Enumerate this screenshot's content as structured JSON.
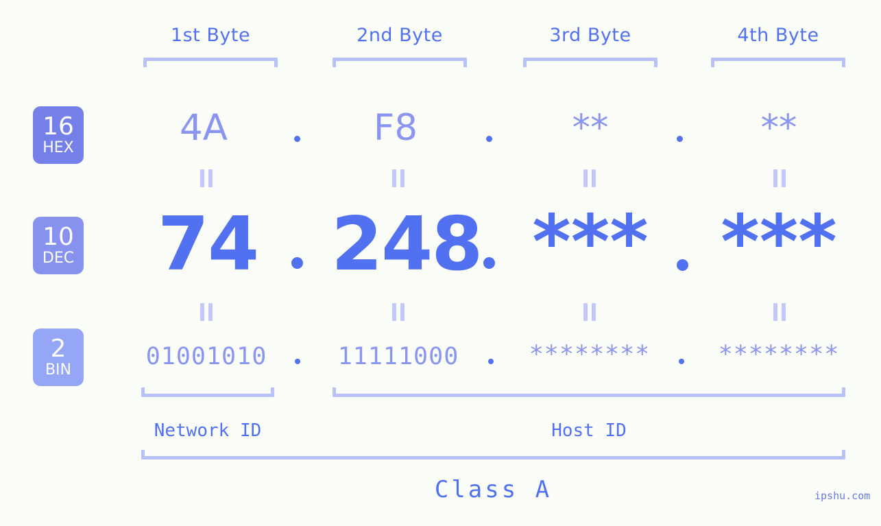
{
  "meta": {
    "background_color": "#fbfdf9",
    "accent_color": "#5271f0",
    "muted_accent_color": "#8a95ef",
    "bracket_color": "#b9c2f8",
    "watermark": "ipshu.com"
  },
  "byte_headers": [
    {
      "label": "1st Byte"
    },
    {
      "label": "2nd Byte"
    },
    {
      "label": "3rd Byte"
    },
    {
      "label": "4th Byte"
    }
  ],
  "bases": [
    {
      "number": "16",
      "name": "HEX",
      "color": "#7480e8"
    },
    {
      "number": "10",
      "name": "DEC",
      "color": "#8692ee"
    },
    {
      "number": "2",
      "name": "BIN",
      "color": "#94a6f5"
    }
  ],
  "rows": {
    "hex": {
      "values": [
        "4A",
        "F8",
        "**",
        "**"
      ],
      "separator": "."
    },
    "dec": {
      "values": [
        "74",
        "248",
        "***",
        "***"
      ],
      "separator": "."
    },
    "bin": {
      "values": [
        "01001010",
        "11111000",
        "********",
        "********"
      ],
      "separator": "."
    }
  },
  "separators": {
    "equals": "||"
  },
  "id_sections": [
    {
      "label": "Network ID"
    },
    {
      "label": "Host ID"
    }
  ],
  "class": {
    "label": "Class A"
  }
}
